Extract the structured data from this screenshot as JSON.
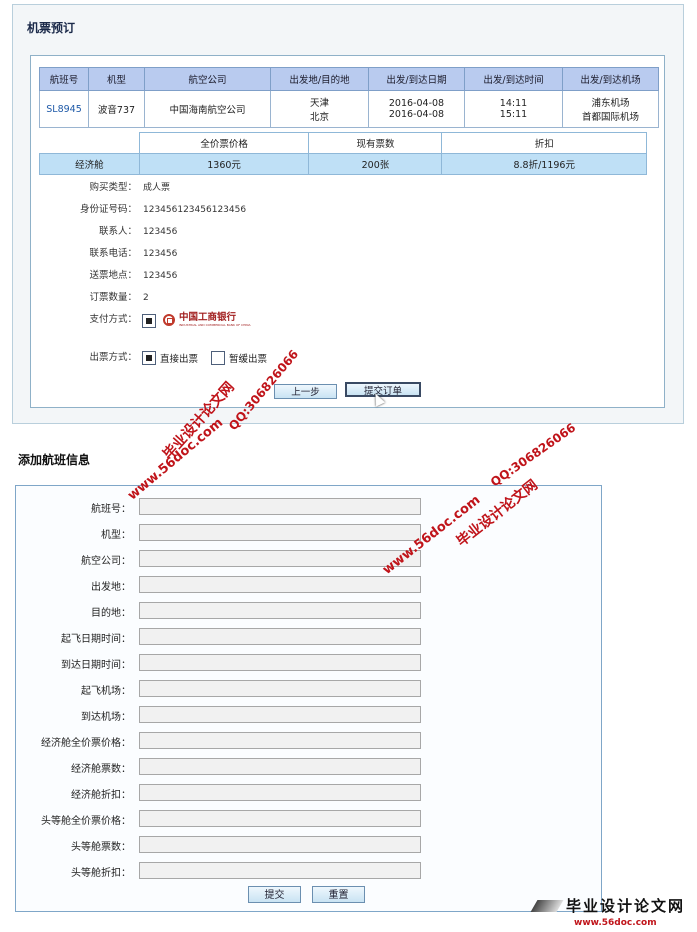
{
  "booking": {
    "title": "机票预订",
    "table_headers": [
      "航班号",
      "机型",
      "航空公司",
      "出发地/目的地",
      "出发/到达日期",
      "出发/到达时间",
      "出发/到达机场"
    ],
    "flight": {
      "flight_no": "SL8945",
      "aircraft": "波音737",
      "airline": "中国海南航空公司",
      "origin": "天津",
      "destination": "北京",
      "dep_date": "2016-04-08",
      "arr_date": "2016-04-08",
      "dep_time": "14:11",
      "arr_time": "15:11",
      "dep_airport": "浦东机场",
      "arr_airport": "首都国际机场"
    },
    "price_headers": [
      "全价票价格",
      "现有票数",
      "折扣"
    ],
    "price_row": {
      "cabin": "经济舱",
      "full_price": "1360元",
      "tickets": "200张",
      "discount": "8.8折/1196元"
    },
    "fields": [
      {
        "label": "购买类型：",
        "value": "成人票"
      },
      {
        "label": "身份证号码：",
        "value": "123456123456123456"
      },
      {
        "label": "联系人：",
        "value": "123456"
      },
      {
        "label": "联系电话：",
        "value": "123456"
      },
      {
        "label": "送票地点：",
        "value": "123456"
      },
      {
        "label": "订票数量：",
        "value": "2"
      }
    ],
    "payment_label": "支付方式：",
    "bank_name": "中国工商银行",
    "bank_subtitle": "INDUSTRIAL AND COMMERCIAL BANK OF CHINA",
    "ticket_label": "出票方式：",
    "ticket_options": [
      "直接出票",
      "暂缓出票"
    ],
    "ticket_selected": "直接出票",
    "prev_button": "上一步",
    "submit_button": "提交订单"
  },
  "add_flight": {
    "title": "添加航班信息",
    "fields": [
      "航班号：",
      "机型：",
      "航空公司：",
      "出发地：",
      "目的地：",
      "起飞日期时间：",
      "到达日期时间：",
      "起飞机场：",
      "到达机场：",
      "经济舱全价票价格：",
      "经济舱票数：",
      "经济舱折扣：",
      "头等舱全价票价格：",
      "头等舱票数：",
      "头等舱折扣："
    ],
    "submit_button": "提交",
    "reset_button": "重置"
  },
  "watermarks": {
    "site_name": "毕业设计论文网",
    "url": "www.56doc.com",
    "qq": "QQ:306826066",
    "footer_brand": "毕业设计论文网",
    "footer_url": "www.56doc.com"
  }
}
